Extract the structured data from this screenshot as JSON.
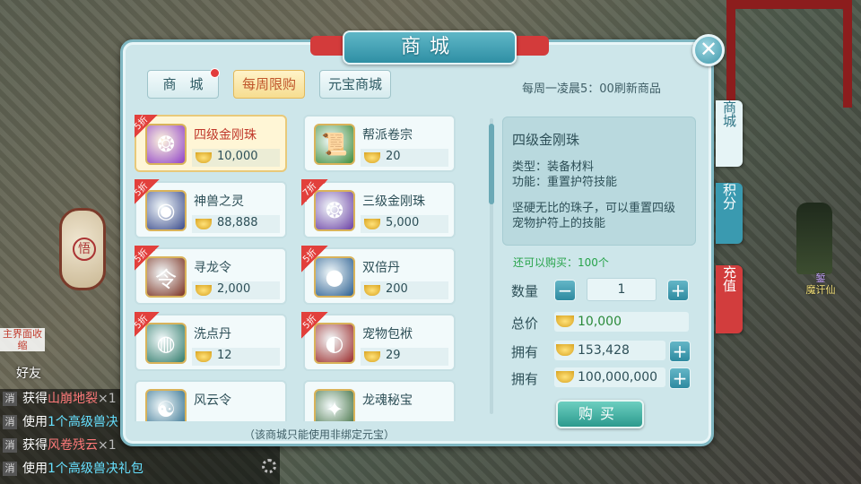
{
  "window": {
    "title": "商城",
    "close_label": "✕"
  },
  "top_tabs": [
    {
      "label": "商　城",
      "active": false
    },
    {
      "label": "每周限购",
      "active": true
    },
    {
      "label": "元宝商城",
      "active": false
    }
  ],
  "refresh_note": "每周一凌晨5：00刷新商品",
  "side_tabs": [
    "商城",
    "积分",
    "充值"
  ],
  "items": [
    {
      "name": "四级金刚珠",
      "price": "10,000",
      "badge": "5折",
      "icon": "purple-orb-icon",
      "color": "#8e3fc7",
      "glyph": "❂"
    },
    {
      "name": "帮派卷宗",
      "price": "20",
      "badge": "",
      "icon": "scroll-icon",
      "color": "#3d8b3a",
      "glyph": "📜"
    },
    {
      "name": "神兽之灵",
      "price": "88,888",
      "badge": "5折",
      "icon": "beast-spirit-icon",
      "color": "#3a4a8a",
      "glyph": "◉"
    },
    {
      "name": "三级金刚珠",
      "price": "5,000",
      "badge": "7折",
      "icon": "green-orb-icon",
      "color": "#6a3fa3",
      "glyph": "❂"
    },
    {
      "name": "寻龙令",
      "price": "2,000",
      "badge": "5折",
      "icon": "dragon-token-icon",
      "color": "#7a3020",
      "glyph": "令"
    },
    {
      "name": "双倍丹",
      "price": "200",
      "badge": "5折",
      "icon": "double-pill-icon",
      "color": "#2a5e90",
      "glyph": "●"
    },
    {
      "name": "洗点丹",
      "price": "12",
      "badge": "5折",
      "icon": "reset-pill-icon",
      "color": "#2f7a6a",
      "glyph": "◍"
    },
    {
      "name": "宠物包袱",
      "price": "29",
      "badge": "5折",
      "icon": "pet-bag-icon",
      "color": "#9a2a2a",
      "glyph": "◐"
    },
    {
      "name": "风云令",
      "price": "",
      "badge": "",
      "icon": "wind-token-icon",
      "color": "#2a6a8a",
      "glyph": "☯"
    },
    {
      "name": "龙魂秘宝",
      "price": "",
      "badge": "",
      "icon": "dragon-soul-icon",
      "color": "#3a6a3a",
      "glyph": "✦"
    }
  ],
  "footer_note": "（该商城只能使用非绑定元宝）",
  "detail": {
    "title": "四级金刚珠",
    "type_line": "类型：装备材料",
    "func_line": "功能：重置护符技能",
    "desc": "坚硬无比的珠子，可以重置四级宠物护符上的技能"
  },
  "purchase": {
    "can_buy": "还可以购买：100个",
    "qty_label": "数量",
    "qty_value": "1",
    "minus": "−",
    "plus": "+",
    "total_label": "总价",
    "total_value": "10,000",
    "own_label_1": "拥有",
    "own_value_1": "153,428",
    "own_label_2": "拥有",
    "own_value_2": "100,000,000",
    "buy_label": "购买"
  },
  "hud": {
    "collapse_label": "主界面收缩",
    "friend_label": "好友",
    "chat": [
      {
        "tag": "消",
        "pre": "获得",
        "hl": "山崩地裂",
        "hl_class": "hl-r",
        "post": "×1"
      },
      {
        "tag": "消",
        "pre": "使用",
        "hl": "1个高级兽决",
        "hl_class": "hl-c",
        "post": ""
      },
      {
        "tag": "消",
        "pre": "获得",
        "hl": "风卷残云",
        "hl_class": "hl-r",
        "post": "×1"
      },
      {
        "tag": "消",
        "pre": "使用",
        "hl": "1个高级兽决礼包",
        "hl_class": "hl-c",
        "post": ""
      }
    ],
    "npc_name_1": "錾",
    "npc_name_2": "魔讦仙"
  }
}
